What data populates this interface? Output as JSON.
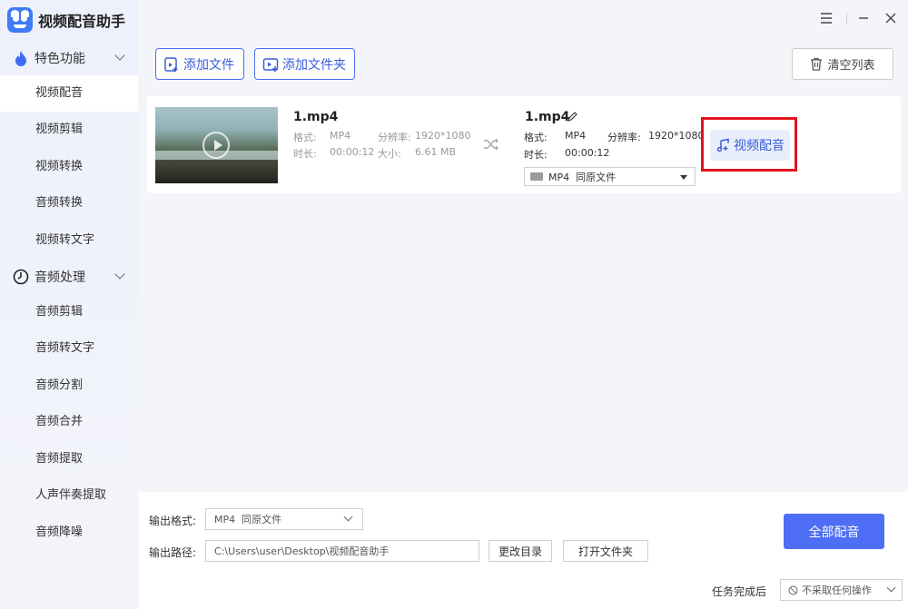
{
  "app": {
    "title": "视频配音助手"
  },
  "sidebar": {
    "groups": [
      {
        "label": "特色功能",
        "items": [
          "视频配音",
          "视频剪辑",
          "视频转换",
          "音频转换",
          "视频转文字"
        ]
      },
      {
        "label": "音频处理",
        "items": [
          "音频剪辑",
          "音频转文字",
          "音频分割",
          "音频合并",
          "音频提取",
          "人声伴奏提取",
          "音频降噪"
        ]
      }
    ],
    "active_item": "视频配音"
  },
  "toolbar": {
    "add_file": "添加文件",
    "add_folder": "添加文件夹",
    "clear_list": "清空列表"
  },
  "file": {
    "source": {
      "name": "1.mp4",
      "format_label": "格式:",
      "format": "MP4",
      "resolution_label": "分辨率:",
      "resolution": "1920*1080",
      "duration_label": "时长:",
      "duration": "00:00:12",
      "size_label": "大小:",
      "size": "6.61 MB"
    },
    "output": {
      "name": "1.mp4",
      "format_label": "格式:",
      "format": "MP4",
      "resolution_label": "分辨率:",
      "resolution": "1920*1080",
      "duration_label": "时长:",
      "duration": "00:00:12",
      "select_value": "MP4  同原文件"
    },
    "action": "视频配音"
  },
  "bottom": {
    "format_label": "输出格式:",
    "format_value": "MP4  同原文件",
    "path_label": "输出路径:",
    "path_value": "C:\\Users\\user\\Desktop\\视频配音助手",
    "change_dir": "更改目录",
    "open_folder": "打开文件夹",
    "run_all": "全部配音",
    "after_task_label": "任务完成后",
    "after_task_value": "不采取任何操作"
  },
  "colors": {
    "accent": "#4d6ef5",
    "highlight": "#e0141e",
    "sidebar_bg": "#eef1fb"
  }
}
